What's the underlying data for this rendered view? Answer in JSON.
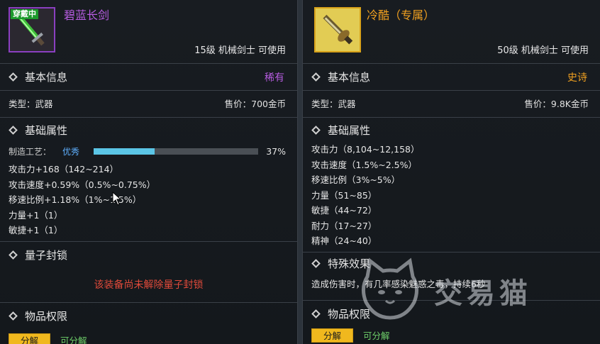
{
  "left": {
    "badge": "穿戴中",
    "name": "碧蓝长剑",
    "name_color": "#b65ce0",
    "requirement": "15级 机械剑士 可使用",
    "basic": {
      "title": "基本信息",
      "rarity": "稀有",
      "rarity_color": "#b65ce0",
      "type": "类型：武器",
      "price": "售价：700金币"
    },
    "attrs": {
      "title": "基础属性",
      "craft_label": "制造工艺：",
      "craft_quality": "优秀",
      "craft_fraction": 0.37,
      "craft_pct": "37%",
      "stats": [
        "攻击力+168（142~214）",
        "攻击速度+0.59%（0.5%~0.75%）",
        "移速比例+1.18%（1%~1.5%）",
        "力量+1（1）",
        "敏捷+1（1）"
      ]
    },
    "seal": {
      "title": "量子封锁",
      "text": "该装备尚未解除量子封锁"
    },
    "perm": {
      "title": "物品权限",
      "button": "分解",
      "status": "可分解"
    }
  },
  "right": {
    "name": "冷酷（专属）",
    "name_color": "#f0a020",
    "requirement": "50级 机械剑士 可使用",
    "basic": {
      "title": "基本信息",
      "rarity": "史诗",
      "rarity_color": "#f0a020",
      "type": "类型：武器",
      "price": "售价：9.8K金币"
    },
    "attrs": {
      "title": "基础属性",
      "stats": [
        "攻击力（8,104~12,158）",
        "攻击速度（1.5%~2.5%）",
        "移速比例（3%~5%）",
        "力量（51~85）",
        "敏捷（44~72）",
        "耐力（17~27）",
        "精神（24~40）"
      ]
    },
    "effect": {
      "title": "特殊效果",
      "text": "造成伤害时，有几率感染魅惑之毒，持续6秒"
    },
    "perm": {
      "title": "物品权限",
      "button": "分解",
      "status": "可分解"
    }
  },
  "watermark": "交易猫",
  "icons": [
    "sword-icon",
    "diamond-icon",
    "cursor-icon",
    "cat-logo-icon"
  ]
}
